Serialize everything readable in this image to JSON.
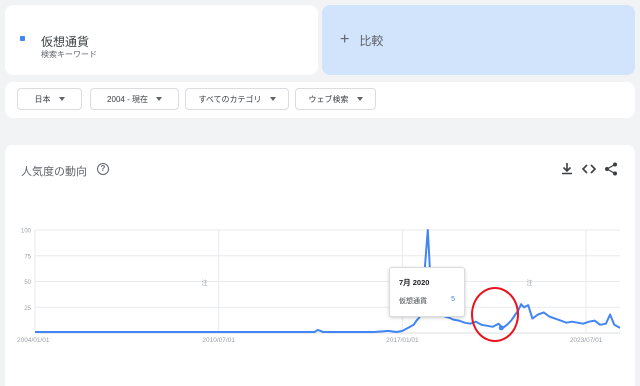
{
  "search": {
    "term": "仮想通貨",
    "term_type": "検索キーワード",
    "term_color": "#4285f4"
  },
  "compare": {
    "label": "比較",
    "icon": "plus-icon"
  },
  "filters": [
    {
      "label": "日本"
    },
    {
      "label": "2004 - 現在"
    },
    {
      "label": "すべてのカテゴリ"
    },
    {
      "label": "ウェブ検索"
    }
  ],
  "chart_card": {
    "title": "人気度の動向",
    "help_icon": "help-circle-icon",
    "tools": [
      "download-icon",
      "embed-code-icon",
      "share-icon"
    ]
  },
  "chart_data": {
    "type": "line",
    "title": "",
    "xlabel": "",
    "ylabel": "",
    "ylim": [
      0,
      100
    ],
    "y_ticks": [
      "100",
      "75",
      "50",
      "25"
    ],
    "x_ticks": [
      "2004/01/01",
      "2010/07/01",
      "2017/01/01",
      "2023/07/01"
    ],
    "x_tick_positions": [
      2004.0,
      2010.5,
      2017.0,
      2023.5
    ],
    "xlim": [
      2004.0,
      2024.7
    ],
    "grid": true,
    "note_markers": [
      "注",
      "注",
      "注"
    ],
    "note_marker_positions": [
      2010.0,
      2016.75,
      2021.5
    ],
    "series": [
      {
        "name": "仮想通貨",
        "color": "#4285f4",
        "x": [
          2004.0,
          2013.9,
          2014.0,
          2014.2,
          2015.0,
          2016.0,
          2016.5,
          2016.8,
          2017.0,
          2017.2,
          2017.4,
          2017.5,
          2017.6,
          2017.7,
          2017.75,
          2017.8,
          2017.9,
          2017.95,
          2018.0,
          2018.05,
          2018.1,
          2018.15,
          2018.25,
          2018.35,
          2018.5,
          2018.65,
          2018.8,
          2019.0,
          2019.2,
          2019.4,
          2019.6,
          2019.8,
          2020.0,
          2020.2,
          2020.4,
          2020.55,
          2020.7,
          2020.85,
          2021.0,
          2021.1,
          2021.2,
          2021.3,
          2021.45,
          2021.6,
          2021.8,
          2022.0,
          2022.2,
          2022.4,
          2022.6,
          2022.8,
          2023.0,
          2023.2,
          2023.4,
          2023.6,
          2023.8,
          2024.0,
          2024.2,
          2024.35,
          2024.5,
          2024.7
        ],
        "values": [
          1,
          1,
          3,
          1,
          1,
          1,
          2,
          1,
          2,
          5,
          8,
          12,
          15,
          28,
          40,
          65,
          100,
          75,
          45,
          38,
          34,
          30,
          24,
          20,
          16,
          15,
          13,
          12,
          10,
          9,
          11,
          8,
          7,
          6,
          9,
          5,
          8,
          12,
          18,
          22,
          28,
          25,
          27,
          14,
          18,
          20,
          16,
          14,
          12,
          10,
          11,
          10,
          9,
          11,
          12,
          8,
          9,
          18,
          8,
          5
        ]
      }
    ]
  },
  "tooltip": {
    "date": "7月 2020",
    "term": "仮想通貨",
    "value": "5"
  }
}
